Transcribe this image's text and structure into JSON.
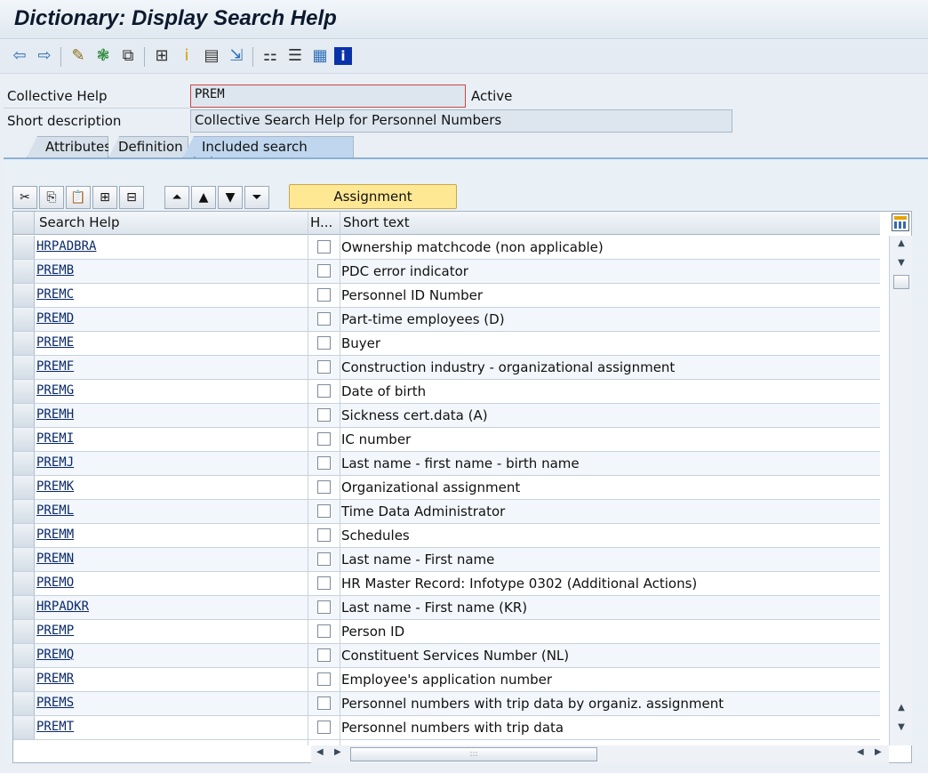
{
  "window": {
    "title": "Dictionary: Display Search Help"
  },
  "toolbar": {
    "icons": [
      "back-arrow-icon",
      "forward-arrow-icon",
      "display-change-icon",
      "other-object-icon",
      "activate-icon",
      "where-used-icon",
      "info-system-icon",
      "object-list-icon",
      "display-object-list-icon",
      "navigation-window-icon",
      "hierarchy-icon",
      "test-icon",
      "documentation-icon",
      "info-icon"
    ]
  },
  "form": {
    "collective_label": "Collective Help",
    "collective_value": "PREM",
    "status": "Active",
    "short_desc_label": "Short description",
    "short_desc_value": "Collective Search Help for Personnel Numbers"
  },
  "tabs": [
    {
      "label": "Attributes"
    },
    {
      "label": "Definition"
    },
    {
      "label": "Included search helps"
    }
  ],
  "active_tab": "Included search helps",
  "table_toolbar": {
    "assignment_label": "Assignment"
  },
  "table": {
    "columns": [
      "Search Help",
      "H...",
      "Short text"
    ],
    "rows": [
      {
        "name": "HRPADBRA",
        "text": "Ownership matchcode (non applicable)"
      },
      {
        "name": "PREMB",
        "text": "PDC error indicator"
      },
      {
        "name": "PREMC",
        "text": "Personnel ID Number"
      },
      {
        "name": "PREMD",
        "text": "Part-time employees (D)"
      },
      {
        "name": "PREME",
        "text": "Buyer"
      },
      {
        "name": "PREMF",
        "text": "Construction industry - organizational assignment"
      },
      {
        "name": "PREMG",
        "text": "Date of birth"
      },
      {
        "name": "PREMH",
        "text": "Sickness cert.data (A)"
      },
      {
        "name": "PREMI",
        "text": "IC number"
      },
      {
        "name": "PREMJ",
        "text": "Last name - first name - birth name"
      },
      {
        "name": "PREMK",
        "text": "Organizational assignment"
      },
      {
        "name": "PREML",
        "text": "Time Data Administrator"
      },
      {
        "name": "PREMM",
        "text": "Schedules"
      },
      {
        "name": "PREMN",
        "text": "Last name - First name"
      },
      {
        "name": "PREMO",
        "text": "HR Master Record: Infotype 0302 (Additional Actions)"
      },
      {
        "name": "HRPADKR",
        "text": "Last name - First name (KR)"
      },
      {
        "name": "PREMP",
        "text": "Person ID"
      },
      {
        "name": "PREMQ",
        "text": "Constituent Services Number (NL)"
      },
      {
        "name": "PREMR",
        "text": "Employee's application number"
      },
      {
        "name": "PREMS",
        "text": "Personnel numbers with trip data by organiz. assignment"
      },
      {
        "name": "PREMT",
        "text": "Personnel numbers with trip data"
      }
    ]
  }
}
